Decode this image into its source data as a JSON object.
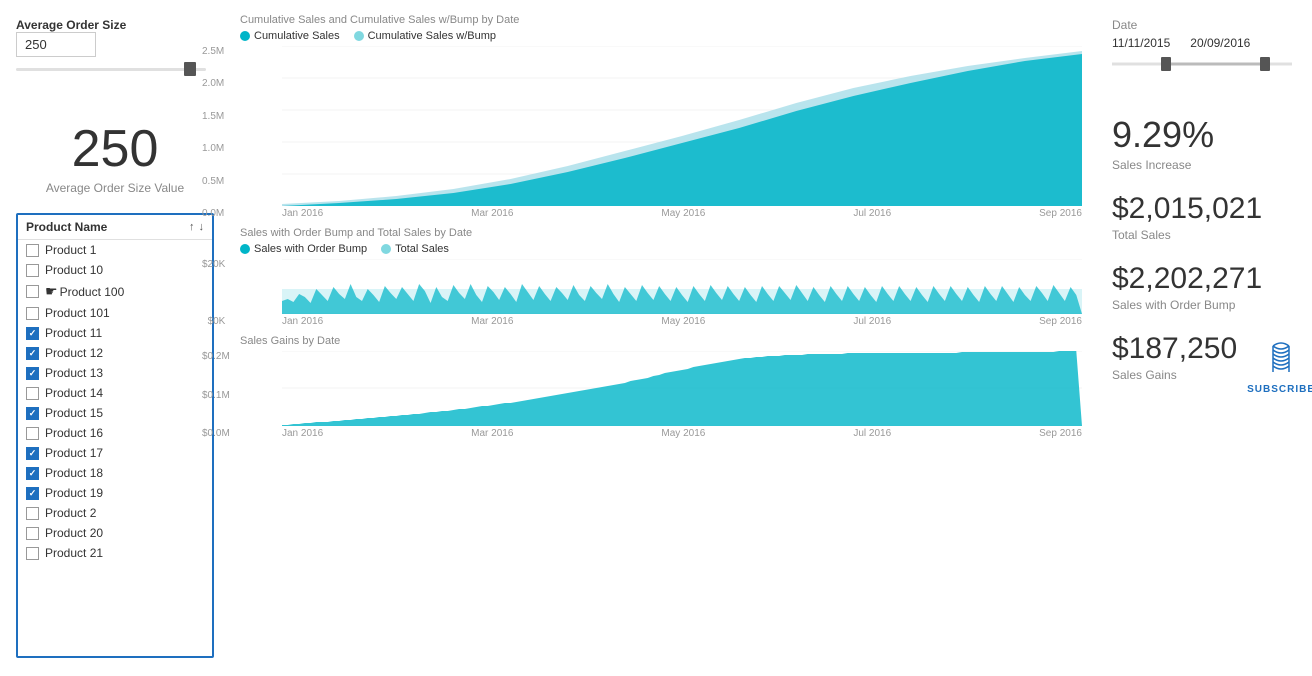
{
  "left": {
    "avg_order_label": "Average Order Size",
    "avg_order_value": "250",
    "avg_order_big": "250",
    "avg_order_sublabel": "Average Order Size Value",
    "product_list_title": "Product Name",
    "products": [
      {
        "name": "Product 1",
        "checked": false
      },
      {
        "name": "Product 10",
        "checked": false
      },
      {
        "name": "Product 100",
        "checked": false,
        "cursor": true
      },
      {
        "name": "Product 101",
        "checked": false
      },
      {
        "name": "Product 11",
        "checked": true
      },
      {
        "name": "Product 12",
        "checked": true
      },
      {
        "name": "Product 13",
        "checked": true
      },
      {
        "name": "Product 14",
        "checked": false
      },
      {
        "name": "Product 15",
        "checked": true
      },
      {
        "name": "Product 16",
        "checked": false
      },
      {
        "name": "Product 17",
        "checked": true
      },
      {
        "name": "Product 18",
        "checked": true
      },
      {
        "name": "Product 19",
        "checked": true
      },
      {
        "name": "Product 2",
        "checked": false
      },
      {
        "name": "Product 20",
        "checked": false
      },
      {
        "name": "Product 21",
        "checked": false
      }
    ]
  },
  "center": {
    "chart1_title": "Cumulative Sales and Cumulative Sales w/Bump by Date",
    "chart1_legend": [
      {
        "label": "Cumulative Sales",
        "color": "#00b5c8"
      },
      {
        "label": "Cumulative Sales w/Bump",
        "color": "#80d8e0"
      }
    ],
    "chart1_y_labels": [
      "2.5M",
      "2.0M",
      "1.5M",
      "1.0M",
      "0.5M",
      "0.0M"
    ],
    "chart1_x_labels": [
      "Jan 2016",
      "Mar 2016",
      "May 2016",
      "Jul 2016",
      "Sep 2016"
    ],
    "chart2_title": "Sales with Order Bump and Total Sales by Date",
    "chart2_legend": [
      {
        "label": "Sales with Order Bump",
        "color": "#00b5c8"
      },
      {
        "label": "Total Sales",
        "color": "#80d8e0"
      }
    ],
    "chart2_y_labels": [
      "$20K",
      "$0K"
    ],
    "chart2_x_labels": [
      "Jan 2016",
      "Mar 2016",
      "May 2016",
      "Jul 2016",
      "Sep 2016"
    ],
    "chart3_title": "Sales Gains by Date",
    "chart3_y_labels": [
      "$0.2M",
      "$0.1M",
      "$0.0M"
    ],
    "chart3_x_labels": [
      "Jan 2016",
      "Mar 2016",
      "May 2016",
      "Jul 2016",
      "Sep 2016"
    ]
  },
  "right": {
    "date_label": "Date",
    "date_start": "11/11/2015",
    "date_end": "20/09/2016",
    "metric1_value": "9.29%",
    "metric1_label": "Sales Increase",
    "metric2_value": "$2,015,021",
    "metric2_label": "Total Sales",
    "metric3_value": "$2,202,271",
    "metric3_label": "Sales with Order Bump",
    "metric4_value": "$187,250",
    "metric4_label": "Sales Gains",
    "subscribe_text": "SUBSCRIBE"
  }
}
